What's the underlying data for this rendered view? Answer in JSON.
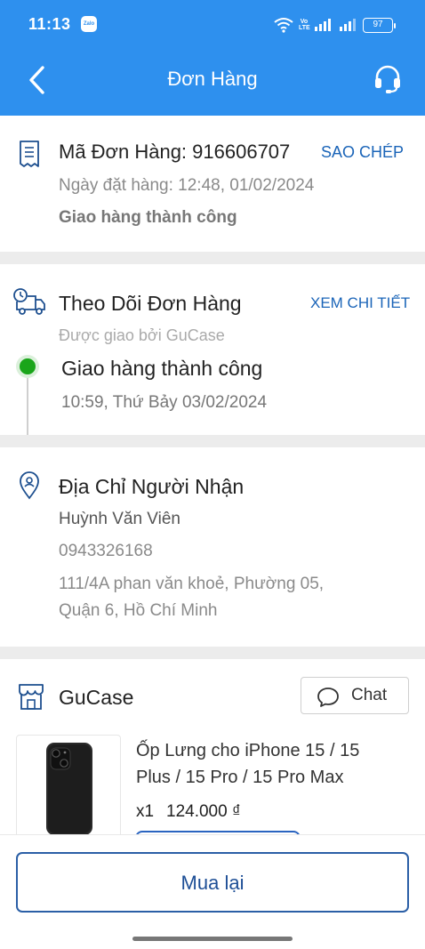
{
  "status_bar": {
    "time": "11:13",
    "zalo_label": "Zalo",
    "volte_label": "Vo LTE",
    "battery": "97"
  },
  "header": {
    "title": "Đơn Hàng"
  },
  "order": {
    "code_label": "Mã Đơn Hàng: 916606707",
    "copy_label": "SAO CHÉP",
    "date": "Ngày đặt hàng: 12:48, 01/02/2024",
    "status": "Giao hàng thành công"
  },
  "tracking": {
    "title": "Theo Dõi Đơn Hàng",
    "detail_link": "XEM CHI TIẾT",
    "carrier": "Được giao bởi GuCase",
    "event_status": "Giao hàng thành công",
    "event_time": "10:59, Thứ Bảy 03/02/2024"
  },
  "address": {
    "title": "Địa Chỉ Người Nhận",
    "name": "Huỳnh Văn Viên",
    "phone": "0943326168",
    "line1": "111/4A phan văn khoẻ, Phường 05,",
    "line2": "Quận 6, Hồ Chí Minh"
  },
  "shop": {
    "name": "GuCase",
    "chat_label": "Chat"
  },
  "product": {
    "name_line1": "Ốp Lưng cho iPhone 15 / 15",
    "name_line2": "Plus / 15 Pro / 15 Pro Max",
    "quantity": "x1",
    "price": "124.000 ₫"
  },
  "footer": {
    "rebuy_label": "Mua lại"
  },
  "colors": {
    "primary": "#2e90ee",
    "link": "#1a64b8",
    "success": "#1aa51a"
  }
}
